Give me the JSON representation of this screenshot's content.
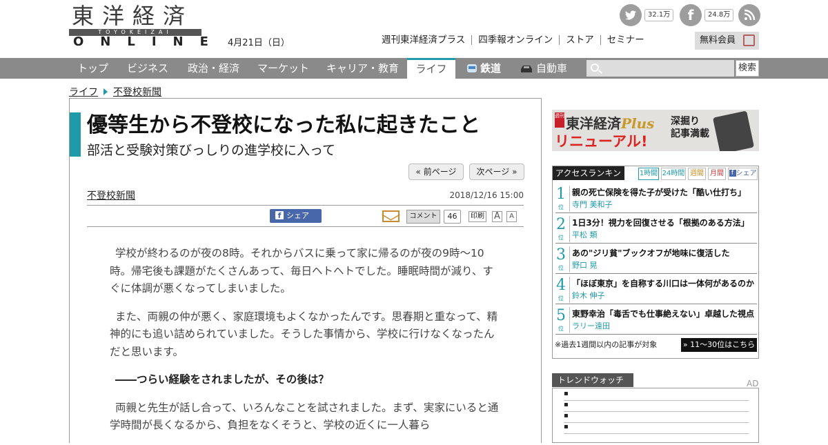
{
  "header": {
    "logo_kanji": "東洋経済",
    "logo_romaji": "TOYOKEIZAI",
    "logo_online": "ONLINE",
    "date": "4月21日（日）",
    "twitter_count": "32.1万",
    "facebook_count": "24.8万",
    "links": [
      "週刊東洋経済プラス",
      "四季報オンライン",
      "ストア",
      "セミナー"
    ],
    "member_label": "無料会員"
  },
  "nav": {
    "items": [
      "トップ",
      "ビジネス",
      "政治・経済",
      "マーケット",
      "キャリア・教育",
      "ライフ",
      "鉄道",
      "自動車"
    ],
    "active": "ライフ",
    "search_placeholder": "",
    "search_button": "検索"
  },
  "breadcrumb": [
    "ライフ",
    "不登校新聞"
  ],
  "article": {
    "title": "優等生から不登校になった私に起きたこと",
    "subtitle": "部活と受験対策びっしりの進学校に入って",
    "prev_page": "« 前ページ",
    "next_page": "次ページ »",
    "category": "不登校新聞",
    "timestamp": "2018/12/16 15:00",
    "share_label": "シェア",
    "comment_label": "コメント",
    "comment_count": "46",
    "print_label": "印刷",
    "font_large": "A",
    "font_small": "A",
    "paragraphs": [
      "学校が終わるのが夜の8時。それからバスに乗って家に帰るのが夜の9時～10時。帰宅後も課題がたくさんあって、毎日ヘトヘトでした。睡眠時間が減り、すぐに体調が悪くなってしまいました。",
      "また、両親の仲が悪く、家庭環境もよくなかったんです。思春期と重なって、精神的にも追い詰められていました。そうした事情から、学校に行けなくなったんだと思います。",
      "――つらい経験をされましたが、その後は？",
      "両親と先生が話し合って、いろんなことを試されました。まず、実家にいると通学時間が長くなるから、負担をなくそうと、学校の近くに一人暮ら"
    ]
  },
  "sidebar": {
    "ad": {
      "weekly": "週刊",
      "name": "東洋経済",
      "plus": "Plus",
      "renewal": "リニューアル!",
      "desc": [
        "深掘り",
        "記事満載"
      ]
    },
    "ranking": {
      "title": "アクセスランキング",
      "tabs": [
        "1時間",
        "24時間",
        "週間",
        "月間",
        "シェア"
      ],
      "position_label": "位",
      "items": [
        {
          "rank": "1",
          "headline": "親の死亡保険を得た子が受けた「酷い仕打ち」",
          "author": "寺門 美和子"
        },
        {
          "rank": "2",
          "headline": "1日3分！視力を回復させる「根拠のある方法」",
          "author": "平松 類"
        },
        {
          "rank": "3",
          "headline": "あの\"ジリ貧\"ブックオフが地味に復活した",
          "author": "野口 晃"
        },
        {
          "rank": "4",
          "headline": "「ほぼ東京」を自称する川口は一体何があるのか",
          "author": "鈴木 伸子"
        },
        {
          "rank": "5",
          "headline": "東野幸治「毒舌でも仕事絶えない」卓越した視点",
          "author": "ラリー遠田"
        }
      ],
      "note": "※過去1週間以内の記事が対象",
      "more": "» 11～30位はこちら"
    },
    "trend_title": "トレンドウォッチ",
    "ad_label": "AD"
  },
  "colors": {
    "accent": "#1e9aa8",
    "nav_bg": "#8a8a8a",
    "facebook": "#4867aa"
  }
}
